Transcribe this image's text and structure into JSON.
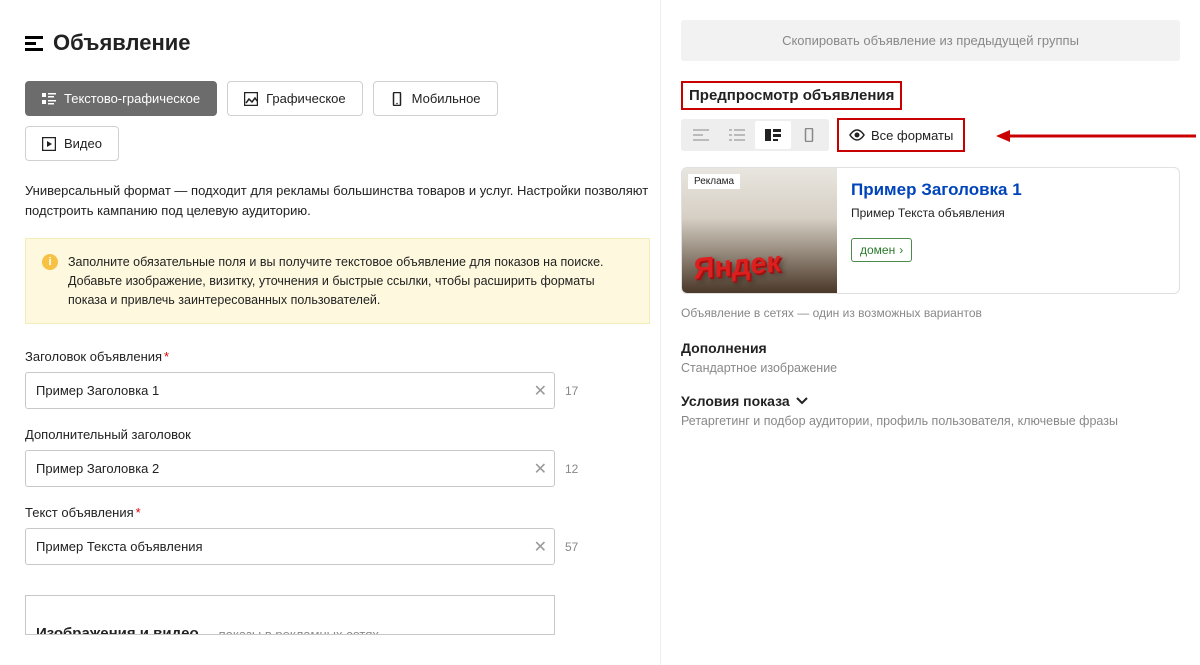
{
  "pageTitle": "Объявление",
  "tabs": {
    "textGraphic": "Текстово-графическое",
    "graphic": "Графическое",
    "mobile": "Мобильное",
    "video": "Видео"
  },
  "description": "Универсальный формат — подходит для рекламы большинства товаров и услуг. Настройки позволяют подстроить кампанию под целевую аудиторию.",
  "alertText": "Заполните обязательные поля и вы получите текстовое объявление для показов на поиске. Добавьте изображение, визитку, уточнения и быстрые ссылки, чтобы расширить форматы показа и привлечь заинтересованных пользователей.",
  "fields": {
    "headline": {
      "label": "Заголовок объявления",
      "value": "Пример Заголовка 1",
      "counter": "17",
      "required": true
    },
    "headline2": {
      "label": "Дополнительный заголовок",
      "value": "Пример Заголовка 2",
      "counter": "12",
      "required": false
    },
    "adText": {
      "label": "Текст объявления",
      "value": "Пример Текста объявления",
      "counter": "57",
      "required": true
    }
  },
  "cutoff": {
    "title": "Изображения и видео",
    "sub": "показы в рекламных сетях"
  },
  "right": {
    "copyBtn": "Скопировать объявление из предыдущей группы",
    "previewTitle": "Предпросмотр объявления",
    "allFormats": "Все форматы",
    "ad": {
      "badge": "Реклама",
      "title": "Пример Заголовка 1",
      "text": "Пример Текста объявления",
      "domain": "домен",
      "logo": "Яндек"
    },
    "previewNote": "Объявление в сетях — один из возможных вариантов",
    "additions": {
      "title": "Дополнения",
      "sub": "Стандартное изображение"
    },
    "conditions": {
      "title": "Условия показа",
      "sub": "Ретаргетинг и подбор аудитории, профиль пользователя, ключевые фразы"
    }
  },
  "icons": {
    "textGraphic": "text-graphic-icon",
    "graphic": "image-icon",
    "mobile": "mobile-icon",
    "video": "play-icon",
    "eye": "eye-icon",
    "chevron": "chevron-down-icon",
    "info": "info-icon",
    "clear": "clear-icon",
    "arrow": "arrow-icon"
  }
}
